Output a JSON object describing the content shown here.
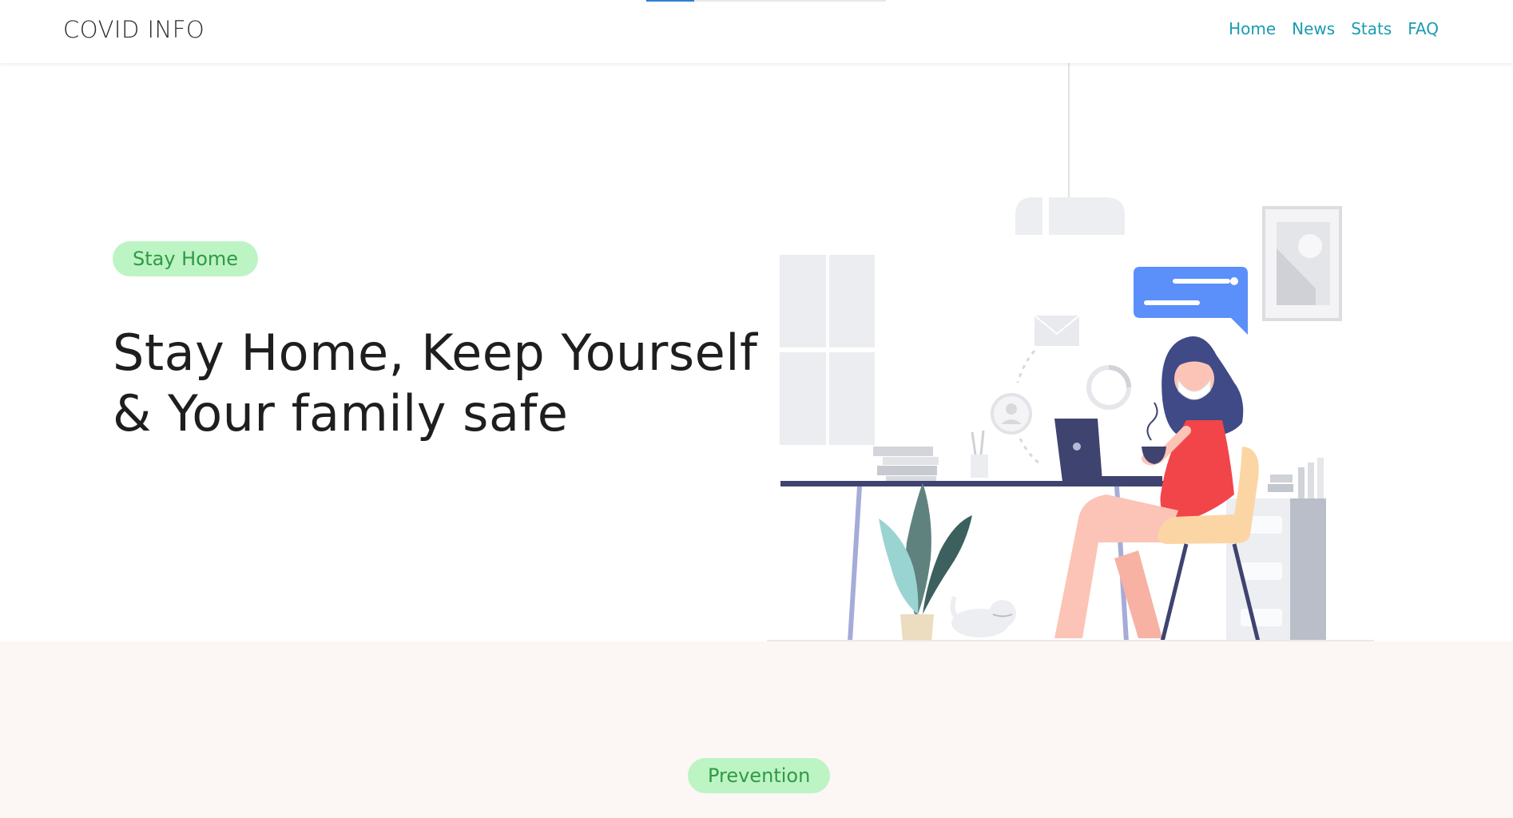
{
  "header": {
    "brand": "COVID INFO",
    "nav": [
      "Home",
      "News",
      "Stats",
      "FAQ"
    ],
    "loading_progress": 0.2
  },
  "hero": {
    "badge": "Stay Home",
    "title_line1": "Stay Home, Keep Yourself",
    "title_line2": "& Your family safe",
    "illustration": "woman-working-from-home-illustration"
  },
  "section2": {
    "badge": "Prevention"
  },
  "colors": {
    "nav_link": "#1b9bb0",
    "badge_bg": "#bdf4c4",
    "badge_text": "#2f9a45",
    "section_bg": "#fcf6f5",
    "progress": "#2f7fd8"
  }
}
